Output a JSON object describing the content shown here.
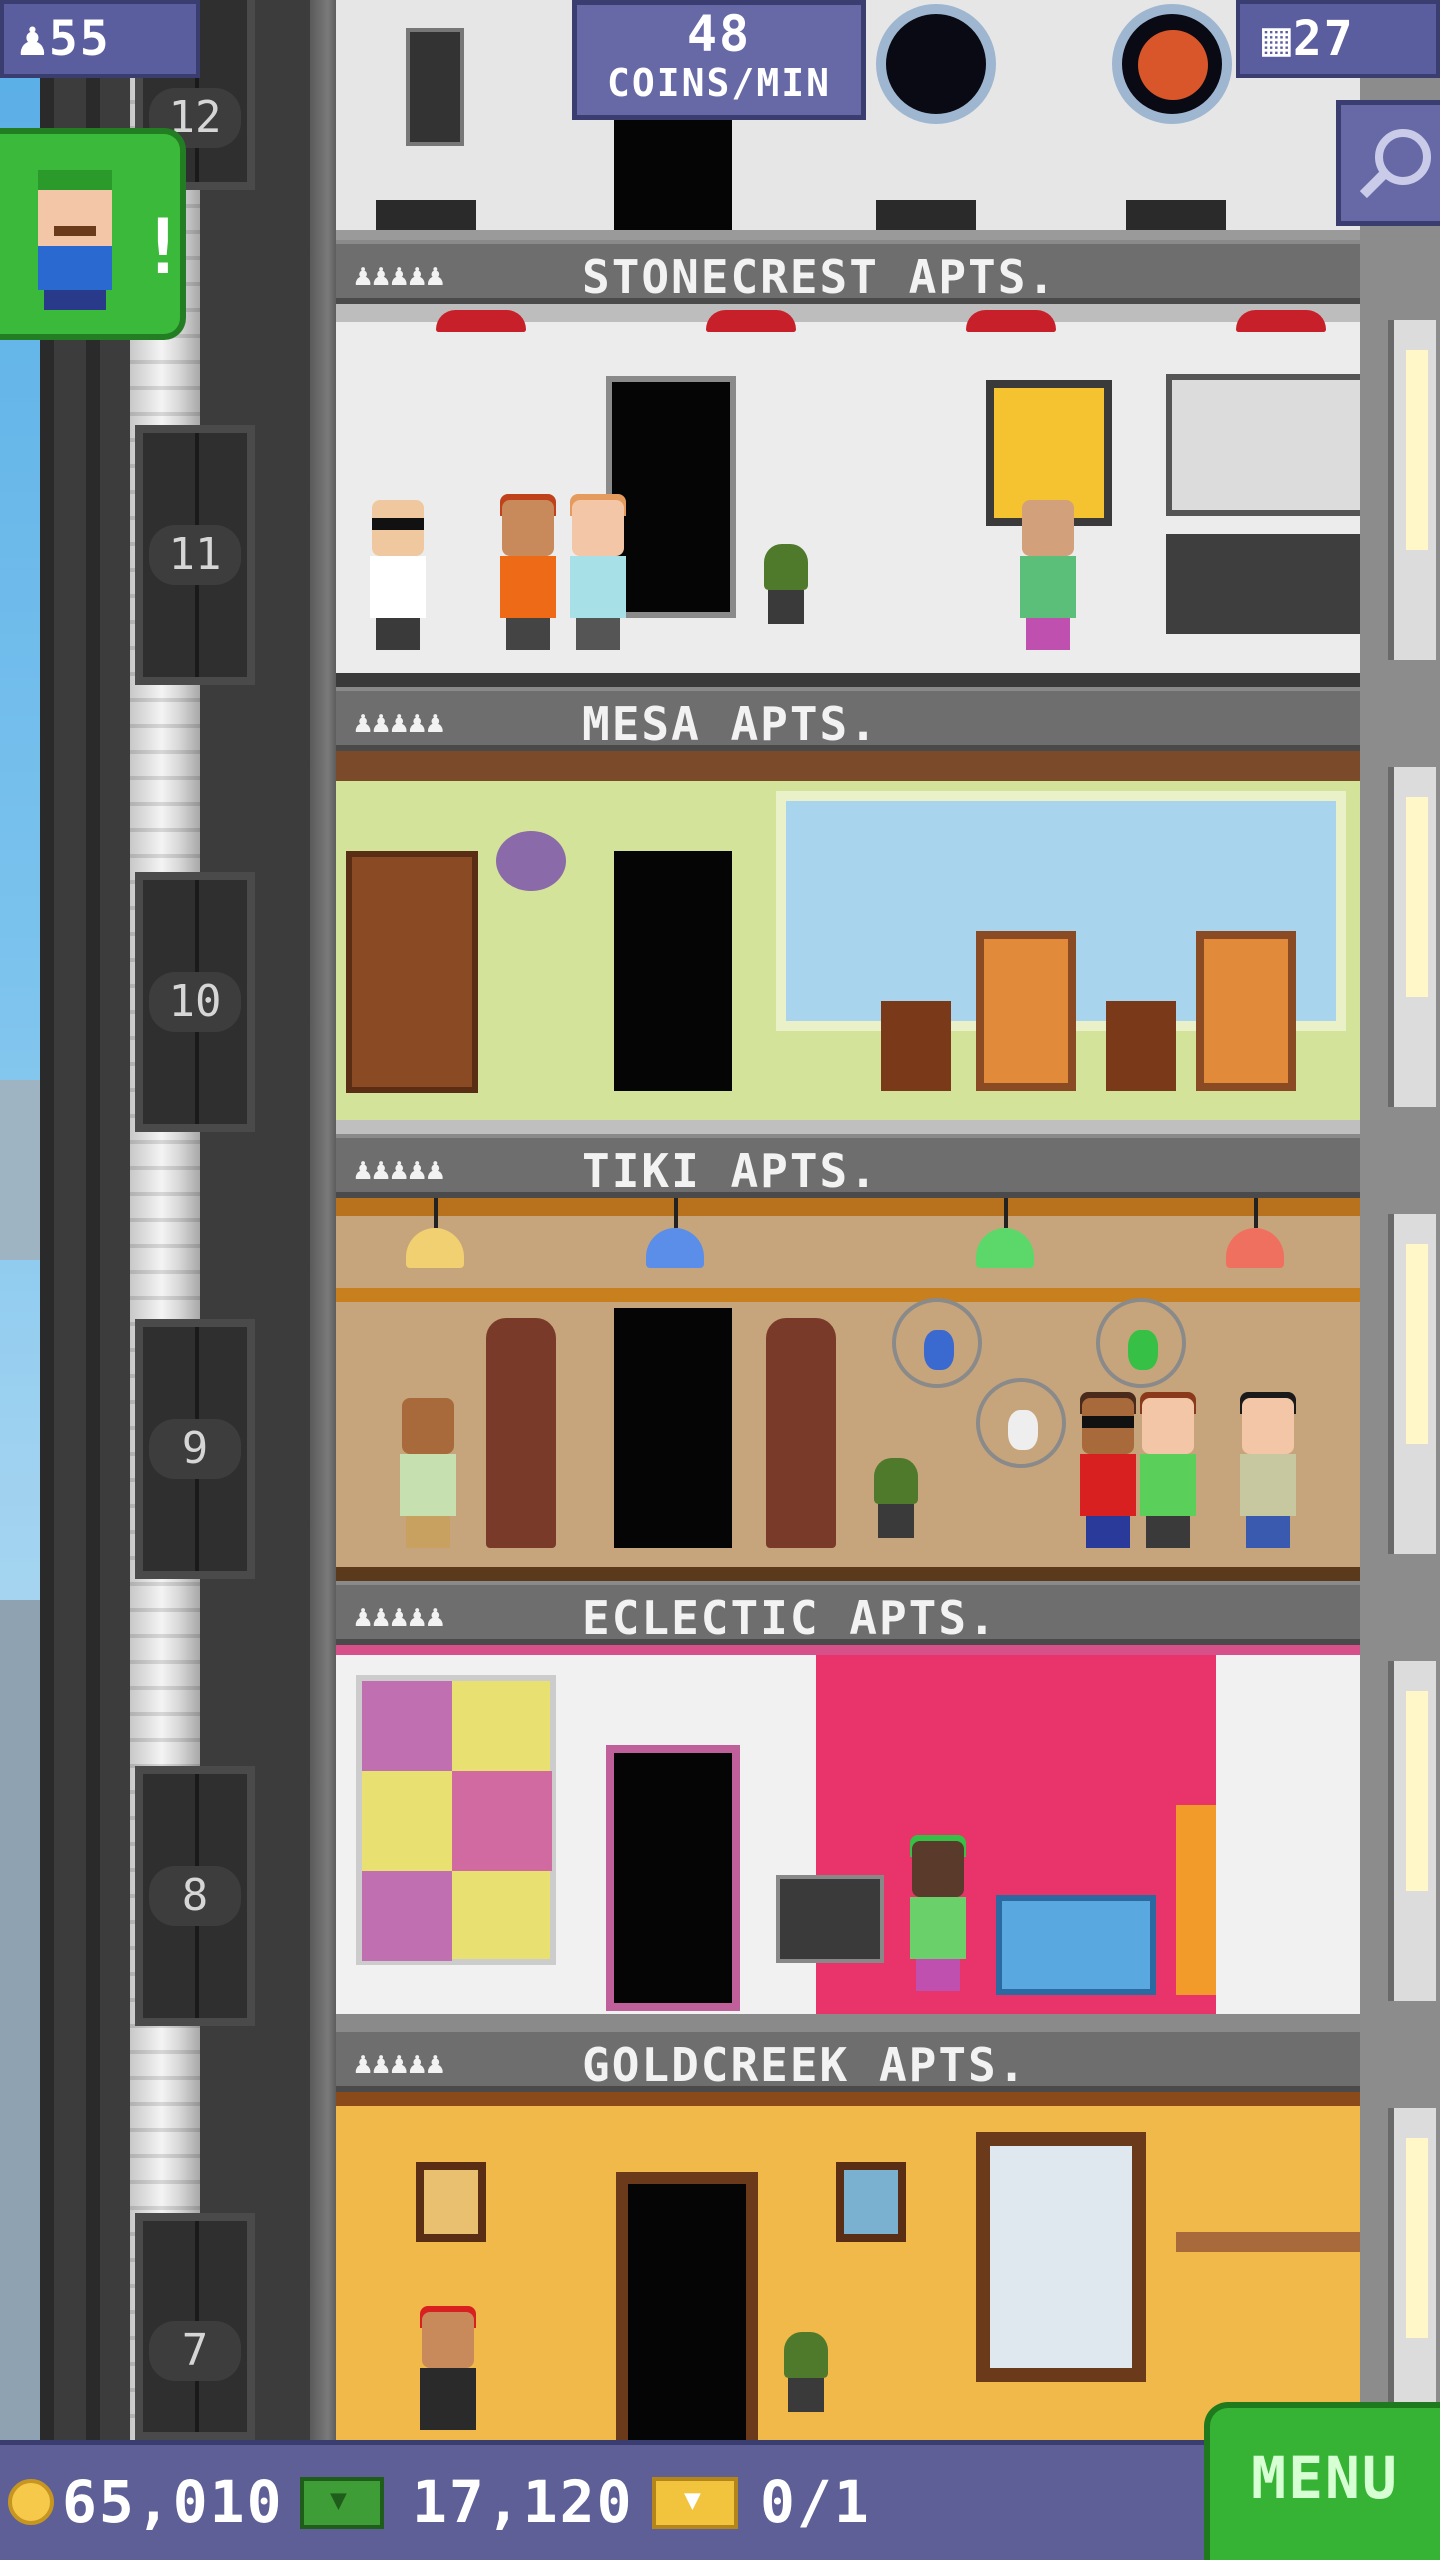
{
  "hud": {
    "population": "55",
    "coins_per_min_value": "48",
    "coins_per_min_label": "COINS/MIN",
    "floor_count": "27"
  },
  "elevator": {
    "floor_numbers": [
      "12",
      "11",
      "10",
      "9",
      "8",
      "7"
    ]
  },
  "floors": [
    {
      "title": "STONECREST APTS.",
      "residents_icon": "♟♟♟♟♟"
    },
    {
      "title": "MESA APTS.",
      "residents_icon": "♟♟♟♟♟"
    },
    {
      "title": "TIKI APTS.",
      "residents_icon": "♟♟♟♟♟"
    },
    {
      "title": "ECLECTIC APTS.",
      "residents_icon": "♟♟♟♟♟"
    },
    {
      "title": "GOLDCREEK APTS.",
      "residents_icon": "♟♟♟♟♟"
    }
  ],
  "visitor_alert": {
    "label": "!"
  },
  "bottom_bar": {
    "coins": "65,010",
    "bux": "17,120",
    "tickets": "0/1",
    "menu_label": "MENU"
  },
  "colors": {
    "hud_purple": "#5a5d9e",
    "menu_green": "#36b334",
    "mesa_wall": "#d4e39a",
    "tiki_wall": "#c7a57c",
    "eclectic_wall": "#f1f1f1",
    "goldcreek_wall": "#f1b84a"
  }
}
